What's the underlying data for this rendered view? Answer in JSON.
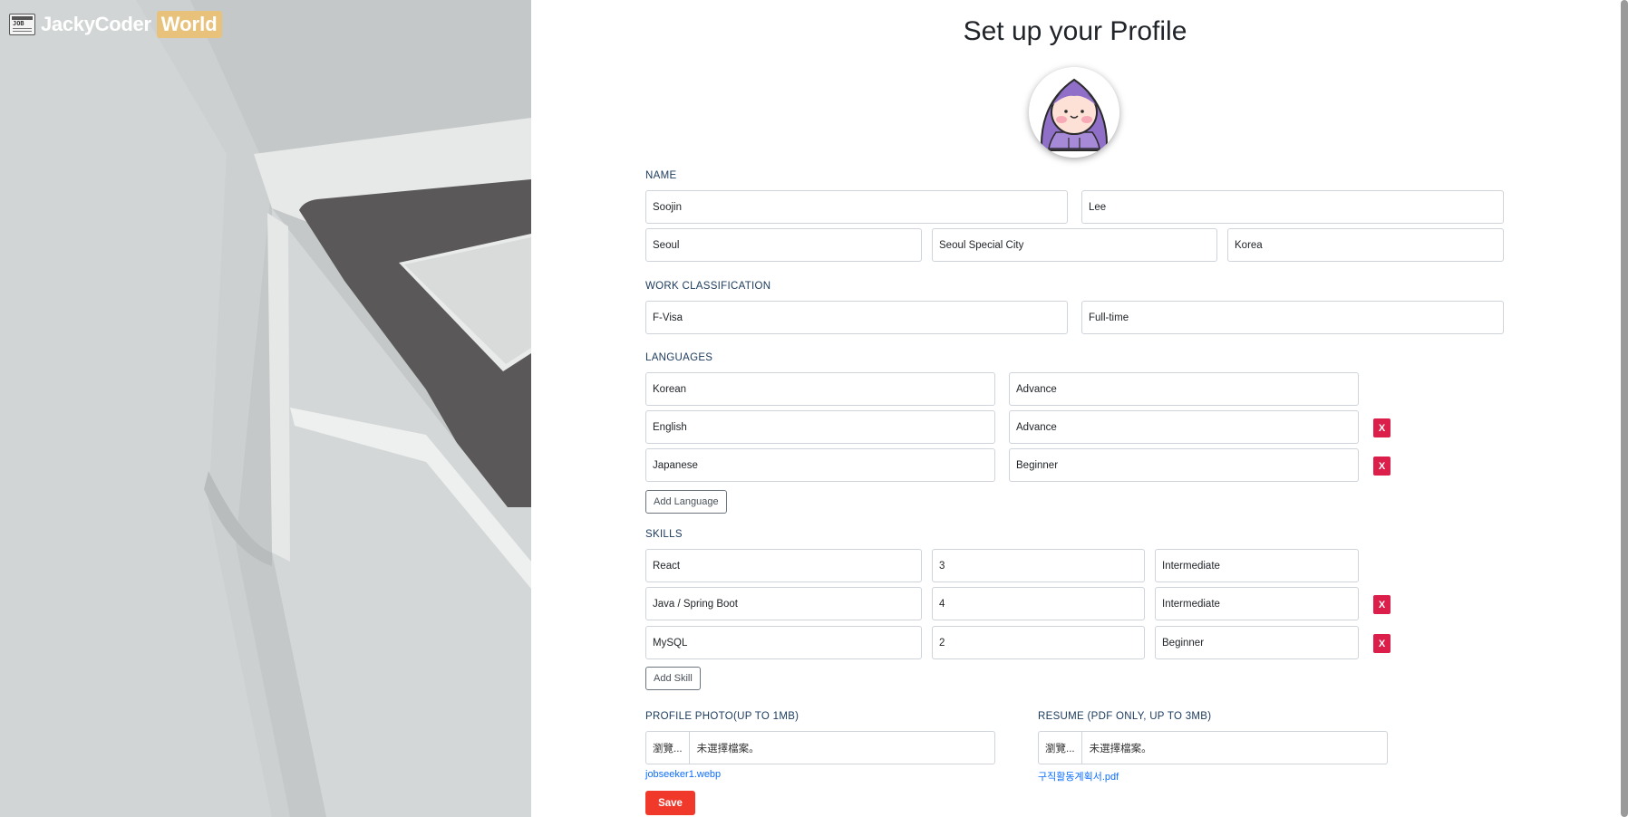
{
  "brand": {
    "name": "JackyCoder",
    "tag": "World",
    "logo_text": "JOB"
  },
  "title": "Set up your Profile",
  "name_section": {
    "label": "NAME",
    "first_name": "Soojin",
    "last_name": "Lee",
    "city": "Seoul",
    "region": "Seoul Special City",
    "country": "Korea"
  },
  "work_section": {
    "label": "WORK CLASSIFICATION",
    "visa": "F-Visa",
    "type": "Full-time"
  },
  "languages_section": {
    "label": "LANGUAGES",
    "items": [
      {
        "language": "Korean",
        "level": "Advance"
      },
      {
        "language": "English",
        "level": "Advance"
      },
      {
        "language": "Japanese",
        "level": "Beginner"
      }
    ],
    "add_label": "Add Language"
  },
  "skills_section": {
    "label": "SKILLS",
    "items": [
      {
        "skill": "React",
        "years": "3",
        "level": "Intermediate"
      },
      {
        "skill": "Java / Spring Boot",
        "years": "4",
        "level": "Intermediate"
      },
      {
        "skill": "MySQL",
        "years": "2",
        "level": "Beginner"
      }
    ],
    "add_label": "Add Skill"
  },
  "remove_label": "X",
  "photo": {
    "label": "PROFILE PHOTO(UP TO 1MB)",
    "browse": "瀏覽...",
    "status": "未選擇檔案。",
    "current_file": "jobseeker1.webp"
  },
  "resume": {
    "label": "RESUME (PDF ONLY, UP TO 3MB)",
    "browse": "瀏覽...",
    "status": "未選擇檔案。",
    "current_file": "구직활동계획서.pdf"
  },
  "save_label": "Save",
  "colors": {
    "brand_tag": "#e8c27a",
    "remove": "#dc1e4a",
    "save": "#f0392b",
    "link": "#0d6efd",
    "label": "#1b3a5c"
  }
}
